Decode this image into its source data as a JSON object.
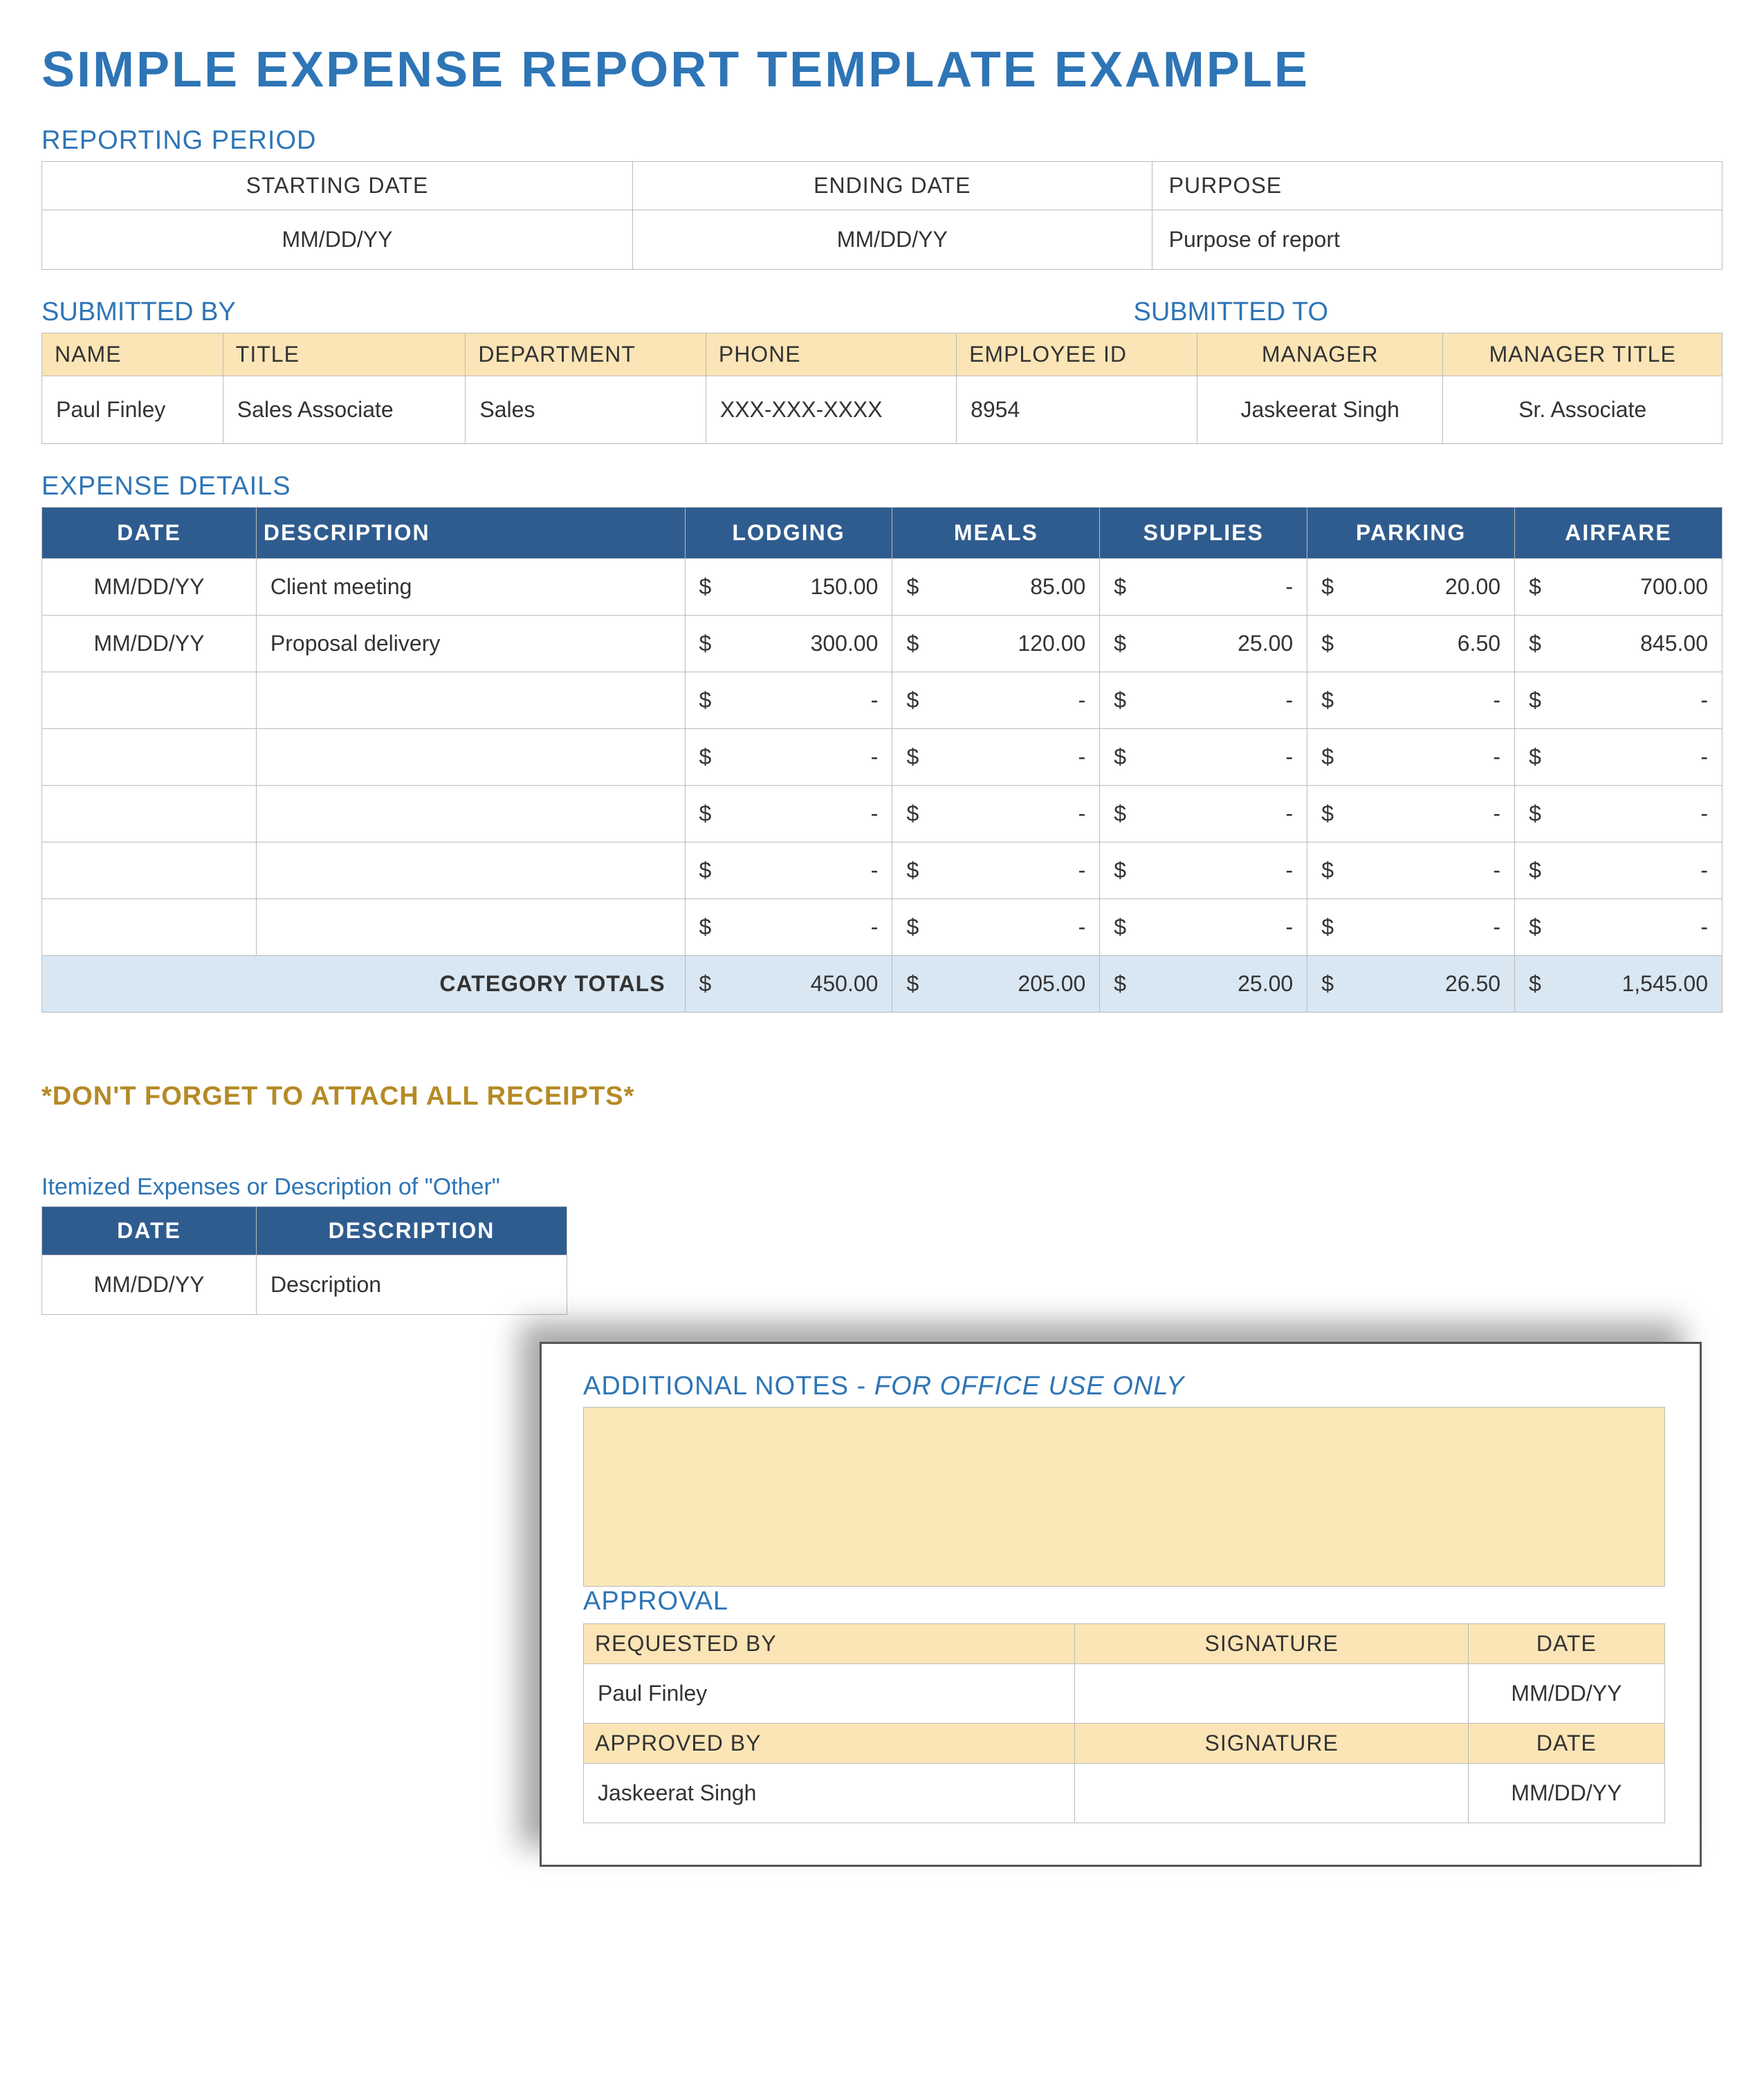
{
  "title": "SIMPLE EXPENSE REPORT TEMPLATE EXAMPLE",
  "reporting_period": {
    "label": "REPORTING PERIOD",
    "headers": {
      "start": "STARTING DATE",
      "end": "ENDING DATE",
      "purpose": "PURPOSE"
    },
    "values": {
      "start": "MM/DD/YY",
      "end": "MM/DD/YY",
      "purpose": "Purpose of report"
    }
  },
  "submitted": {
    "by_label": "SUBMITTED BY",
    "to_label": "SUBMITTED TO",
    "headers": {
      "name": "NAME",
      "title": "TITLE",
      "department": "DEPARTMENT",
      "phone": "PHONE",
      "employee_id": "EMPLOYEE ID",
      "manager": "MANAGER",
      "manager_title": "MANAGER TITLE"
    },
    "row": {
      "name": "Paul Finley",
      "title": "Sales Associate",
      "department": "Sales",
      "phone": "XXX-XXX-XXXX",
      "employee_id": "8954",
      "manager": "Jaskeerat Singh",
      "manager_title": "Sr. Associate"
    }
  },
  "expense": {
    "label": "EXPENSE DETAILS",
    "headers": {
      "date": "DATE",
      "description": "DESCRIPTION",
      "lodging": "LODGING",
      "meals": "MEALS",
      "supplies": "SUPPLIES",
      "parking": "PARKING",
      "airfare": "AIRFARE"
    },
    "currency": "$",
    "rows": [
      {
        "date": "MM/DD/YY",
        "description": "Client meeting",
        "lodging": "150.00",
        "meals": "85.00",
        "supplies": "-",
        "parking": "20.00",
        "airfare": "700.00"
      },
      {
        "date": "MM/DD/YY",
        "description": "Proposal delivery",
        "lodging": "300.00",
        "meals": "120.00",
        "supplies": "25.00",
        "parking": "6.50",
        "airfare": "845.00"
      },
      {
        "date": "",
        "description": "",
        "lodging": "-",
        "meals": "-",
        "supplies": "-",
        "parking": "-",
        "airfare": "-"
      },
      {
        "date": "",
        "description": "",
        "lodging": "-",
        "meals": "-",
        "supplies": "-",
        "parking": "-",
        "airfare": "-"
      },
      {
        "date": "",
        "description": "",
        "lodging": "-",
        "meals": "-",
        "supplies": "-",
        "parking": "-",
        "airfare": "-"
      },
      {
        "date": "",
        "description": "",
        "lodging": "-",
        "meals": "-",
        "supplies": "-",
        "parking": "-",
        "airfare": "-"
      },
      {
        "date": "",
        "description": "",
        "lodging": "-",
        "meals": "-",
        "supplies": "-",
        "parking": "-",
        "airfare": "-"
      }
    ],
    "totals_label": "CATEGORY TOTALS",
    "totals": {
      "lodging": "450.00",
      "meals": "205.00",
      "supplies": "25.00",
      "parking": "26.50",
      "airfare": "1,545.00"
    }
  },
  "reminder": "*DON'T FORGET TO ATTACH ALL RECEIPTS*",
  "itemized": {
    "label": "Itemized Expenses or Description of \"Other\"",
    "headers": {
      "date": "DATE",
      "description": "DESCRIPTION"
    },
    "row": {
      "date": "MM/DD/YY",
      "description": "Description"
    }
  },
  "notes": {
    "label_prefix": "ADDITIONAL NOTES - ",
    "label_italic": "FOR OFFICE USE ONLY"
  },
  "approval": {
    "label": "APPROVAL",
    "headers": {
      "requested_by": "REQUESTED BY",
      "approved_by": "APPROVED BY",
      "signature": "SIGNATURE",
      "date": "DATE"
    },
    "requested": {
      "name": "Paul Finley",
      "signature": "",
      "date": "MM/DD/YY"
    },
    "approved": {
      "name": "Jaskeerat Singh",
      "signature": "",
      "date": "MM/DD/YY"
    }
  }
}
